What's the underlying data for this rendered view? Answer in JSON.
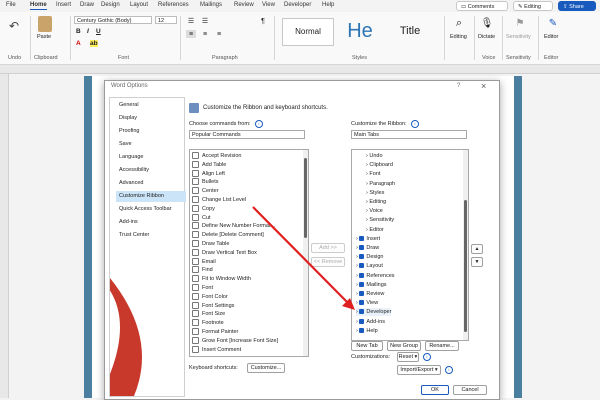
{
  "tabs": [
    "File",
    "Home",
    "Insert",
    "Draw",
    "Design",
    "Layout",
    "References",
    "Mailings",
    "Review",
    "View",
    "Developer",
    "Help"
  ],
  "top_buttons": {
    "comments": "Comments",
    "editing": "Editing",
    "share": "Share"
  },
  "ribbon": {
    "undo_group": "Undo",
    "paste": "Paste",
    "clipboard_group": "Clipboard",
    "font_name": "Century Gothic (Body)",
    "font_size": "12",
    "font_group": "Font",
    "paragraph_group": "Paragraph",
    "styles": [
      "Normal",
      "He",
      "Title"
    ],
    "styles_group": "Styles",
    "editing": "Editing",
    "dictate": "Dictate",
    "voice_group": "Voice",
    "sensitivity": "Sensitivity",
    "sensitivity_group": "Sensitivity",
    "editor": "Editor",
    "editor_group": "Editor"
  },
  "dialog": {
    "title": "Word Options",
    "nav": [
      "General",
      "Display",
      "Proofing",
      "Save",
      "Language",
      "Accessibility",
      "Advanced",
      "Customize Ribbon",
      "Quick Access Toolbar",
      "Add-ins",
      "Trust Center"
    ],
    "heading": "Customize the Ribbon and keyboard shortcuts.",
    "choose_label": "Choose commands from:",
    "choose_value": "Popular Commands",
    "customize_label": "Customize the Ribbon:",
    "customize_value": "Main Tabs",
    "commands": [
      "Accept Revision",
      "Add Table",
      "Align Left",
      "Bullets",
      "Center",
      "Change List Level",
      "Copy",
      "Cut",
      "Define New Number Format...",
      "Delete [Delete Comment]",
      "Draw Table",
      "Draw Vertical Text Box",
      "Email",
      "Find",
      "Fit to Window Width",
      "Font",
      "Font Color",
      "Font Settings",
      "Font Size",
      "Footnote",
      "Format Painter",
      "Grow Font [Increase Font Size]",
      "Insert Comment"
    ],
    "ribbon_items": [
      "Undo",
      "Clipboard",
      "Font",
      "Paragraph",
      "Styles",
      "Editing",
      "Voice",
      "Sensitivity",
      "Editor",
      "Insert",
      "Draw",
      "Design",
      "Layout",
      "References",
      "Mailings",
      "Review",
      "View",
      "Developer",
      "Add-ins",
      "Help"
    ],
    "add_btn": "Add >>",
    "remove_btn": "<< Remove",
    "new_tab": "New Tab",
    "new_group": "New Group",
    "rename": "Rename...",
    "customizations": "Customizations:",
    "reset": "Reset",
    "import_export": "Import/Export",
    "shortcuts_label": "Keyboard shortcuts:",
    "customize_btn": "Customize...",
    "ok": "OK",
    "cancel": "Cancel",
    "question": "?",
    "close": "×"
  },
  "colors": {
    "accent": "#185abd",
    "arrow": "#e02020",
    "doc_bar": "#4a7fa0"
  }
}
